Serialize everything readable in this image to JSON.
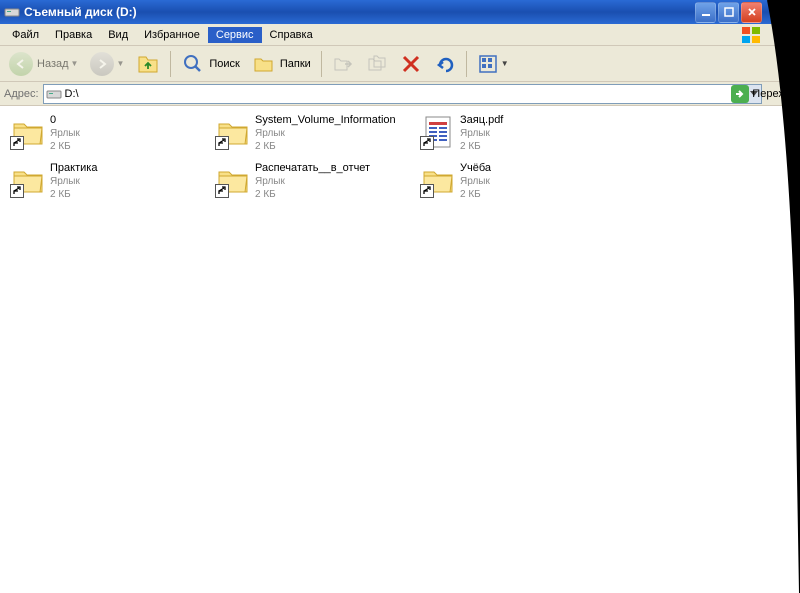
{
  "window": {
    "title": "Съемный диск (D:)"
  },
  "menu": {
    "items": [
      "Файл",
      "Правка",
      "Вид",
      "Избранное",
      "Сервис",
      "Справка"
    ],
    "active_index": 4
  },
  "toolbar": {
    "back_label": "Назад",
    "search_label": "Поиск",
    "folders_label": "Папки"
  },
  "addressbar": {
    "label": "Адрес:",
    "path": "D:\\",
    "go_label": "Переход"
  },
  "files": [
    {
      "name": "0",
      "type": "Ярлык",
      "size": "2 КБ",
      "icon": "folder"
    },
    {
      "name": "System_Volume_Information",
      "type": "Ярлык",
      "size": "2 КБ",
      "icon": "folder"
    },
    {
      "name": "Заяц.pdf",
      "type": "Ярлык",
      "size": "2 КБ",
      "icon": "pdf"
    },
    {
      "name": "Практика",
      "type": "Ярлык",
      "size": "2 КБ",
      "icon": "folder"
    },
    {
      "name": "Распечатать__в_отчет",
      "type": "Ярлык",
      "size": "2 КБ",
      "icon": "folder"
    },
    {
      "name": "Учёба",
      "type": "Ярлык",
      "size": "2 КБ",
      "icon": "folder"
    }
  ]
}
